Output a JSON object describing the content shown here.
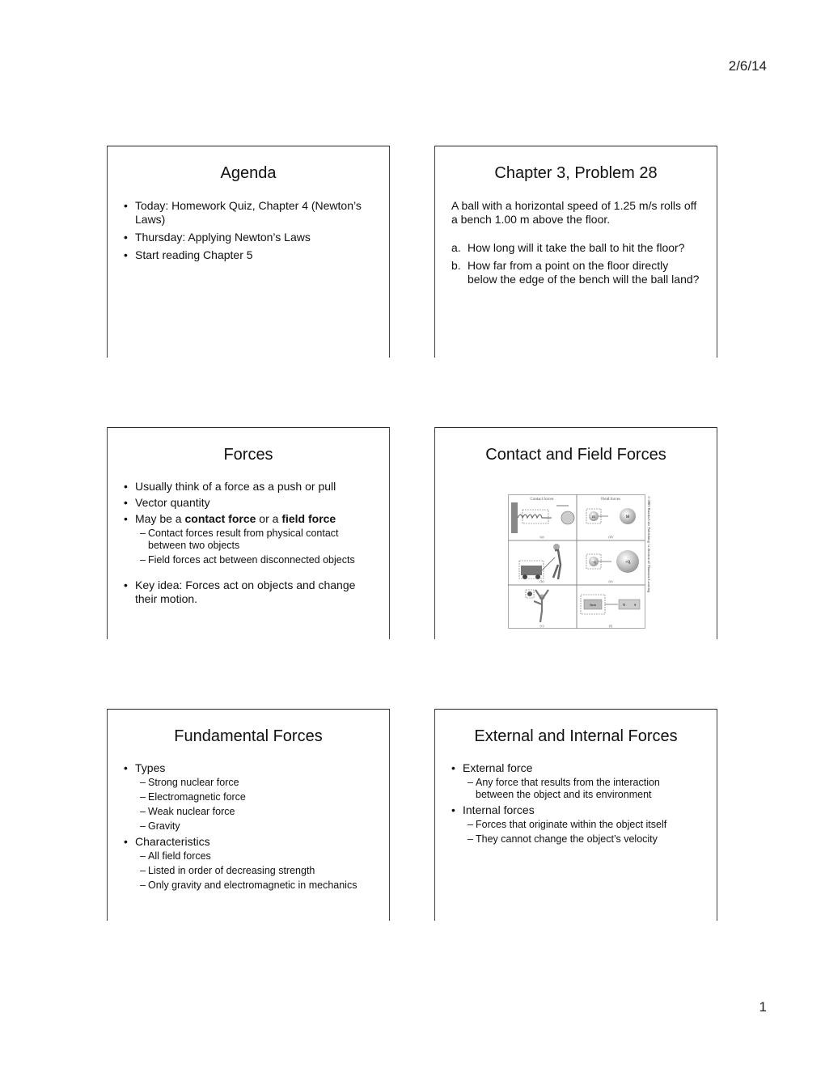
{
  "header": {
    "date": "2/6/14"
  },
  "footer": {
    "page_number": "1"
  },
  "slides": [
    {
      "title": "Agenda",
      "bullets": [
        {
          "text": "Today: Homework Quiz, Chapter 4 (Newton’s Laws)"
        },
        {
          "text": "Thursday: Applying Newton’s Laws"
        },
        {
          "text": "Start reading Chapter 5"
        }
      ]
    },
    {
      "title": "Chapter 3, Problem 28",
      "intro": "A ball with a horizontal speed of 1.25 m/s rolls off a bench 1.00 m above the floor.",
      "questions": [
        {
          "label": "a.",
          "text": "How long will it take the ball to hit the floor?"
        },
        {
          "label": "b.",
          "text": "How far from a point on the floor directly below the edge of the bench will the ball land?"
        }
      ]
    },
    {
      "title": "Forces",
      "bullets": [
        {
          "text": "Usually think of a force as a push or pull"
        },
        {
          "text": "Vector quantity"
        },
        {
          "pre": "May be a ",
          "bold1": "contact force",
          "mid": " or a ",
          "bold2": "field force"
        }
      ],
      "sub": [
        "Contact forces result from physical contact between two objects",
        "Field forces act between disconnected objects"
      ],
      "bullets2": [
        {
          "text": "Key idea: Forces act on objects and change their motion."
        }
      ]
    },
    {
      "title": "Contact and Field Forces",
      "figure": {
        "col1": "Contact forces",
        "col2": "Field forces",
        "labels": [
          "(a)",
          "(d)",
          "(b)",
          "(e)",
          "(c)",
          "(f)"
        ],
        "marks": {
          "m": "m",
          "M": "M",
          "q": "−q",
          "Q": "+Q",
          "iron": "Iron",
          "n": "N",
          "s": "S"
        },
        "credit": "© 2003 Brooks/Cole Publishing / a division of Thomson Learning"
      }
    },
    {
      "title": "Fundamental Forces",
      "bullets": [
        {
          "text": "Types",
          "sub": [
            "Strong nuclear force",
            "Electromagnetic force",
            "Weak nuclear force",
            "Gravity"
          ]
        },
        {
          "text": "Characteristics",
          "sub": [
            "All field forces",
            "Listed in order of decreasing strength",
            "Only gravity and electromagnetic in mechanics"
          ]
        }
      ]
    },
    {
      "title": "External and Internal Forces",
      "bullets": [
        {
          "text": "External force",
          "sub": [
            "Any force that results from the interaction between the object and its environment"
          ]
        },
        {
          "text": "Internal forces",
          "sub": [
            "Forces that originate within the object itself",
            "They cannot change the object’s velocity"
          ]
        }
      ]
    }
  ]
}
